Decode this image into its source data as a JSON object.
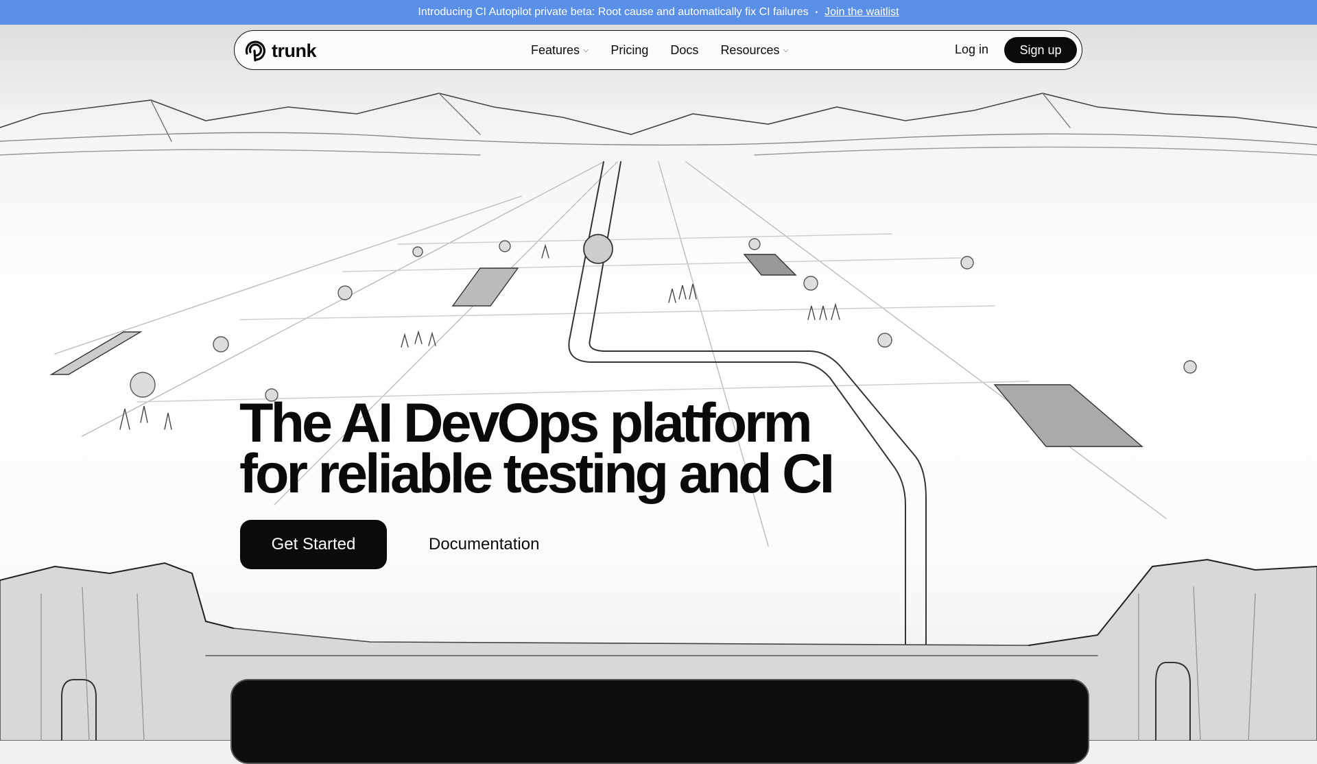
{
  "banner": {
    "text": "Introducing CI Autopilot private beta: Root cause and automatically fix CI failures",
    "separator": "•",
    "link": "Join the waitlist",
    "color": "#5a8fe8"
  },
  "nav": {
    "brand": "trunk",
    "items": [
      {
        "label": "Features",
        "dropdown": true
      },
      {
        "label": "Pricing",
        "dropdown": false
      },
      {
        "label": "Docs",
        "dropdown": false
      },
      {
        "label": "Resources",
        "dropdown": true
      }
    ],
    "chevron": "⌵",
    "login": "Log in",
    "signup": "Sign up"
  },
  "hero": {
    "title_line1": "The AI DevOps platform",
    "title_line2": "for reliable testing and CI",
    "primary_cta": "Get Started",
    "secondary_cta": "Documentation"
  },
  "icons": {
    "logo": "trunk-logo-icon",
    "dropdown": "chevron-down-icon"
  }
}
